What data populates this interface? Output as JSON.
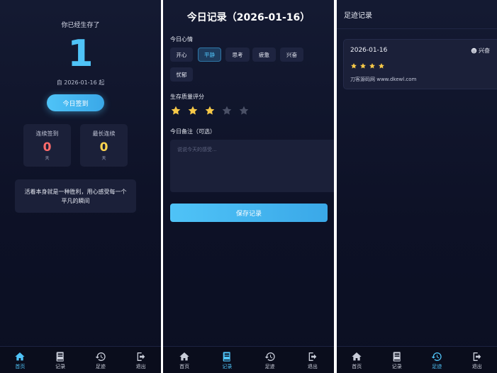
{
  "colors": {
    "accent": "#4fc3f7",
    "star_gold": "#f7c948",
    "star_empty": "#4a5066",
    "streak_red": "#ff6b6b",
    "streak_yellow": "#ffd54f"
  },
  "nav": {
    "home": "首页",
    "record": "记录",
    "history": "足迹",
    "logout": "退出"
  },
  "home": {
    "survival_label": "你已经生存了",
    "day_count": "1",
    "since_date": "自 2026-01-16 起",
    "checkin_button": "今日签到",
    "streak": {
      "label": "连续签到",
      "value": "0",
      "unit": "天"
    },
    "longest": {
      "label": "最长连续",
      "value": "0",
      "unit": "天"
    },
    "quote": "活着本身就是一种胜利，用心感受每一个平凡的瞬间"
  },
  "record": {
    "title": "今日记录（2026-01-16）",
    "mood_label": "今日心情",
    "moods": [
      "开心",
      "平静",
      "思考",
      "疲惫",
      "兴奋",
      "忧郁"
    ],
    "selected_mood": "平静",
    "rating_label": "生存质量评分",
    "rating": 3,
    "rating_max": 5,
    "note_label": "今日备注（可选）",
    "note_placeholder": "说说今天的感受...",
    "save_button": "保存记录"
  },
  "history": {
    "title": "足迹记录",
    "entries": [
      {
        "date": "2026-01-16",
        "mood": "兴奋",
        "rating": 4,
        "note": "刀客源码网 www.dkewl.com"
      }
    ]
  }
}
